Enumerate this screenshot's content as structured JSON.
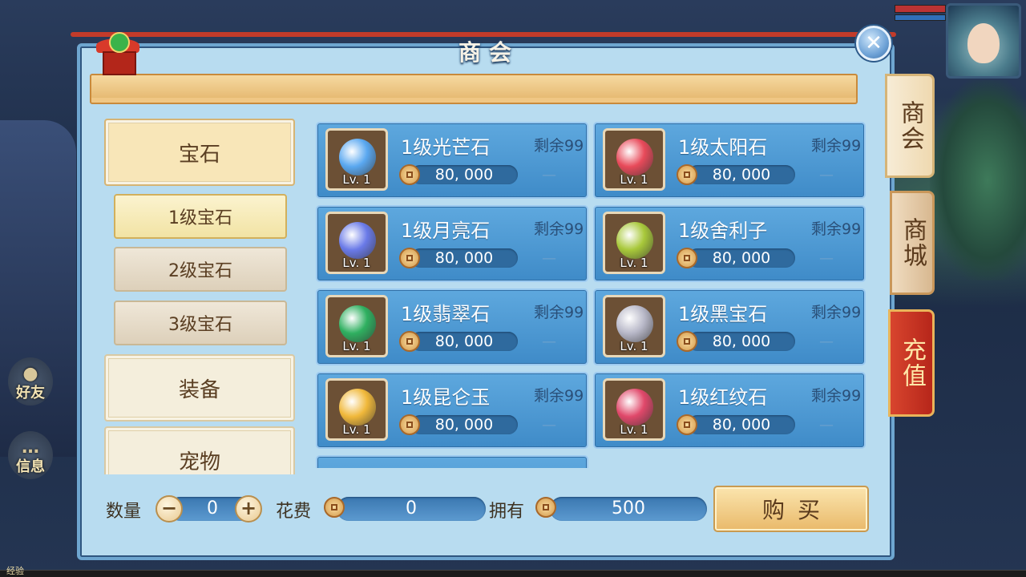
{
  "background": {
    "side_buttons": [
      {
        "label": "好友",
        "icon": "friends-icon"
      },
      {
        "label": "信息",
        "icon": "chat-bubble-icon"
      }
    ],
    "exp_label": "经验"
  },
  "shop": {
    "title": "商会",
    "close_icon": "close-icon",
    "categories": {
      "gem": "宝石",
      "gem_lv1": "1级宝石",
      "gem_lv2": "2级宝石",
      "gem_lv3": "3级宝石",
      "equipment": "装备",
      "pet": "宠物"
    },
    "items": [
      {
        "name": "1级光芒石",
        "level": "Lv. 1",
        "stock": "剩余99",
        "price": "80, 000",
        "dash": "—",
        "color": "#5aa8f0"
      },
      {
        "name": "1级太阳石",
        "level": "Lv. 1",
        "stock": "剩余99",
        "price": "80, 000",
        "dash": "—",
        "color": "#e84a5a"
      },
      {
        "name": "1级月亮石",
        "level": "Lv. 1",
        "stock": "剩余99",
        "price": "80, 000",
        "dash": "—",
        "color": "#6a7ae8"
      },
      {
        "name": "1级舍利子",
        "level": "Lv. 1",
        "stock": "剩余99",
        "price": "80, 000",
        "dash": "—",
        "color": "#a8c83a"
      },
      {
        "name": "1级翡翠石",
        "level": "Lv. 1",
        "stock": "剩余99",
        "price": "80, 000",
        "dash": "—",
        "color": "#2fb060"
      },
      {
        "name": "1级黑宝石",
        "level": "Lv. 1",
        "stock": "剩余99",
        "price": "80, 000",
        "dash": "—",
        "color": "#b8b8c8"
      },
      {
        "name": "1级昆仑玉",
        "level": "Lv. 1",
        "stock": "剩余99",
        "price": "80, 000",
        "dash": "—",
        "color": "#f0b83a"
      },
      {
        "name": "1级红纹石",
        "level": "Lv. 1",
        "stock": "剩余99",
        "price": "80, 000",
        "dash": "—",
        "color": "#e0486a"
      }
    ],
    "footer": {
      "quantity_label": "数量",
      "quantity_value": "0",
      "minus": "−",
      "plus": "+",
      "cost_label": "花费",
      "cost_value": "0",
      "owned_label": "拥有",
      "owned_value": "500",
      "buy_label": "购买"
    }
  },
  "right_tabs": {
    "shop": "商会",
    "mall": "商城",
    "recharge": "充值"
  }
}
